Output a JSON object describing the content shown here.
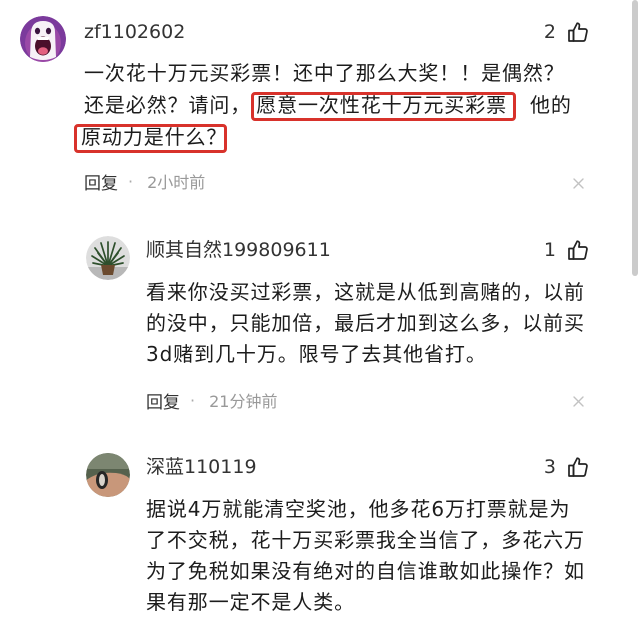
{
  "comments": [
    {
      "username": "zf1102602",
      "likes": "2",
      "lines": [
        [
          {
            "text": "一次花十万元买彩票！还中了那么大奖！！是偶然？",
            "highlight": false
          }
        ],
        [
          {
            "text": "还是必然？请问，",
            "highlight": false
          },
          {
            "text": "愿意一次性花十万元买彩票",
            "highlight": true
          },
          {
            "text": "他的",
            "highlight": false
          }
        ],
        [
          {
            "text": "原动力是什么？",
            "highlight": true
          }
        ]
      ],
      "reply_label": "回复",
      "separator": "·",
      "time": "2小时前"
    },
    {
      "username": "顺其自然199809611",
      "likes": "1",
      "lines": [
        [
          {
            "text": "看来你没买过彩票，这就是从低到高赌的，以前",
            "highlight": false
          }
        ],
        [
          {
            "text": "的没中，只能加倍，最后才加到这么多，以前买",
            "highlight": false
          }
        ],
        [
          {
            "text": "3d赌到几十万。限号了去其他省打。",
            "highlight": false
          }
        ]
      ],
      "reply_label": "回复",
      "separator": "·",
      "time": "21分钟前"
    },
    {
      "username": "深蓝110119",
      "likes": "3",
      "lines": [
        [
          {
            "text": "据说4万就能清空奖池，他多花6万打票就是为",
            "highlight": false
          }
        ],
        [
          {
            "text": "了不交税，花十万买彩票我全当信了，多花六万",
            "highlight": false
          }
        ],
        [
          {
            "text": "为了免税如果没有绝对的自信谁敢如此操作？如",
            "highlight": false
          }
        ],
        [
          {
            "text": "果有那一定不是人类。",
            "highlight": false
          }
        ]
      ]
    }
  ],
  "icons": {
    "like": "thumbs-up-icon",
    "dismiss": "close-icon",
    "avatars": [
      "purple-cartoon-face-avatar",
      "potted-plant-photo-avatar",
      "wrist-bracelet-photo-avatar"
    ]
  },
  "colors": {
    "highlight_border": "#d8322b",
    "text": "#1c1c1c",
    "username": "#333333",
    "meta": "#999999",
    "scrollbar": "#cbcbcb"
  }
}
